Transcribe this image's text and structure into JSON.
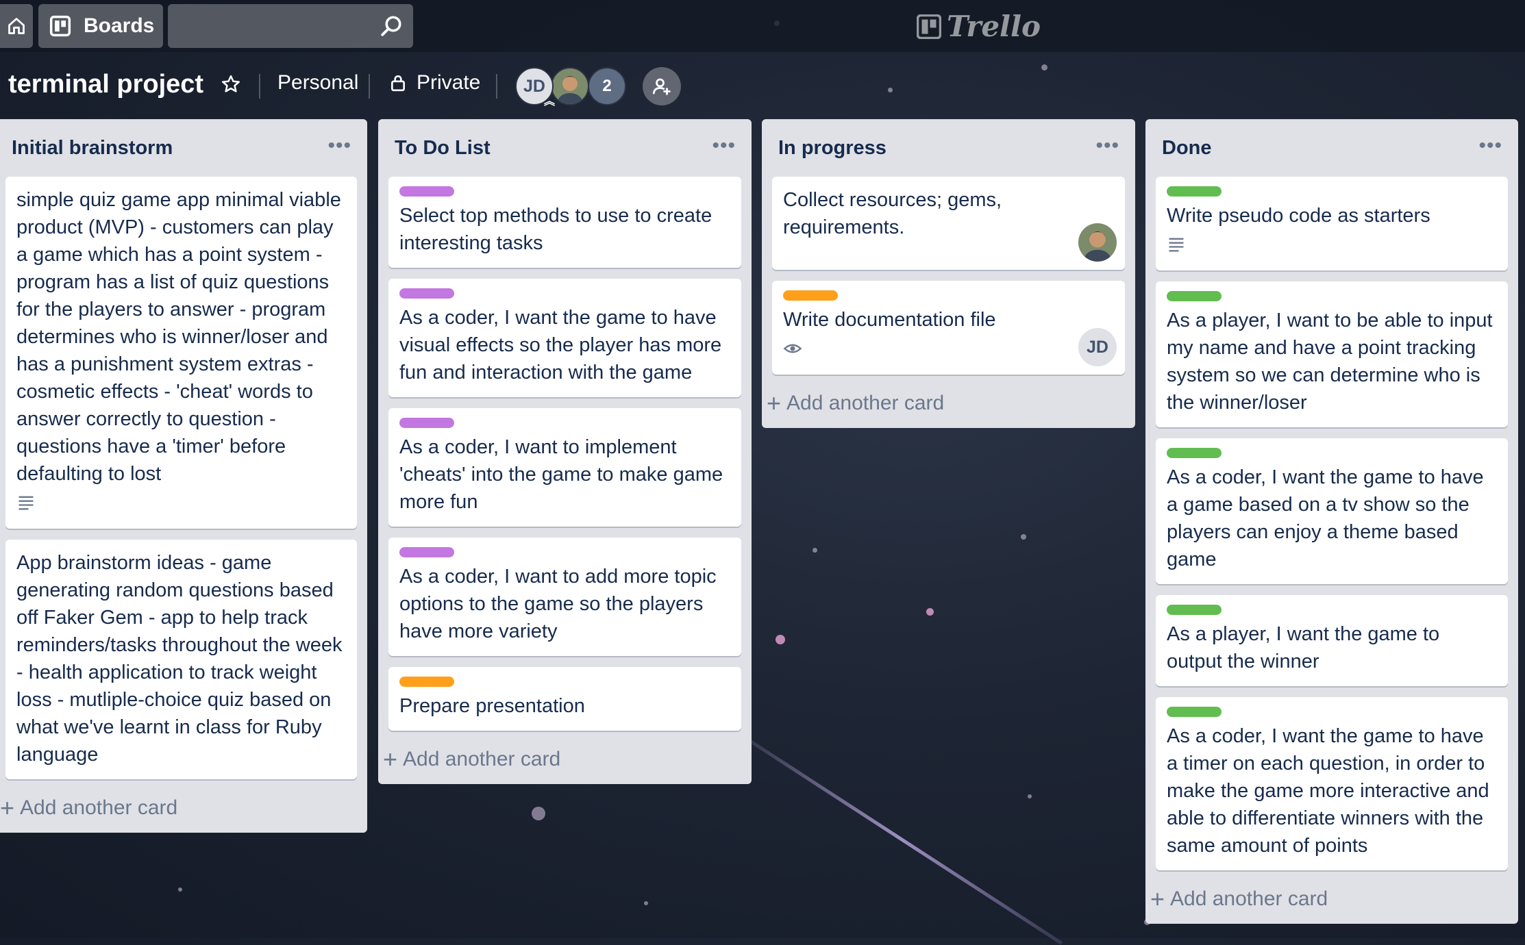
{
  "topbar": {
    "boards_label": "Boards",
    "search_value": "",
    "logo_text": "Trello"
  },
  "board": {
    "title": "terminal project",
    "team": "Personal",
    "visibility": "Private",
    "members": {
      "initials": "JD",
      "extra_count": "2"
    }
  },
  "lists": [
    {
      "title": "Initial brainstorm",
      "menu": "•••",
      "cards": [
        {
          "label": "",
          "text": "simple quiz game app minimal viable product (MVP) - customers can play a game which has a point system - program has a list of quiz questions for the players to answer - program determines who is winner/loser and has a punishment system extras - cosmetic effects - 'cheat' words to answer correctly to question - questions have a 'timer' before defaulting to lost",
          "has_description": true
        },
        {
          "label": "",
          "text": "App brainstorm ideas - game generating random questions based off Faker Gem - app to help track reminders/tasks throughout the week - health application to track weight loss - mutliple-choice quiz based on what we've learnt in class for Ruby language",
          "has_description": false
        }
      ],
      "add_label": "Add another card"
    },
    {
      "title": "To Do List",
      "menu": "•••",
      "cards": [
        {
          "label": "purple",
          "text": "Select top methods to use to create interesting tasks"
        },
        {
          "label": "purple",
          "text": "As a coder, I want the game to have visual effects so the player has more fun and interaction with the game"
        },
        {
          "label": "purple",
          "text": "As a coder, I want to implement 'cheats' into the game to make game more fun"
        },
        {
          "label": "purple",
          "text": "As a coder, I want to add more topic options to the game so the players have more variety"
        },
        {
          "label": "orange",
          "text": "Prepare presentation"
        }
      ],
      "add_label": "Add another card"
    },
    {
      "title": "In progress",
      "menu": "•••",
      "cards": [
        {
          "label": "",
          "text": "Collect resources; gems, requirements.",
          "member": "photo"
        },
        {
          "label": "orange",
          "text": "Write documentation file",
          "member": "JD",
          "watching": true
        }
      ],
      "add_label": "Add another card"
    },
    {
      "title": "Done",
      "menu": "•••",
      "cards": [
        {
          "label": "green",
          "text": "Write pseudo code as starters",
          "has_description": true
        },
        {
          "label": "green",
          "text": "As a player, I want to be able to input my name and have a point tracking system so we can determine who is the winner/loser"
        },
        {
          "label": "green",
          "text": "As a coder, I want the game to have a game based on a tv show so the players can enjoy a theme based game"
        },
        {
          "label": "green",
          "text": "As a player, I want the game to output the winner"
        },
        {
          "label": "green",
          "text": "As a coder, I want the game to have a timer on each question, in order to make the game more interactive and able to differentiate winners with the same amount of points"
        }
      ],
      "add_label": "Add another card"
    }
  ],
  "colors": {
    "label_purple": "#c377e0",
    "label_green": "#61bd4f",
    "label_orange": "#ff9f1a",
    "list_bg": "#dfe1e6",
    "text": "#172b4d"
  },
  "icons": [
    "home-icon",
    "boards-icon",
    "search-icon",
    "trello-logo-icon",
    "star-icon",
    "lock-icon",
    "admin-chevron-icon",
    "add-member-icon",
    "list-menu-icon",
    "description-icon",
    "watch-icon",
    "plus-icon"
  ]
}
